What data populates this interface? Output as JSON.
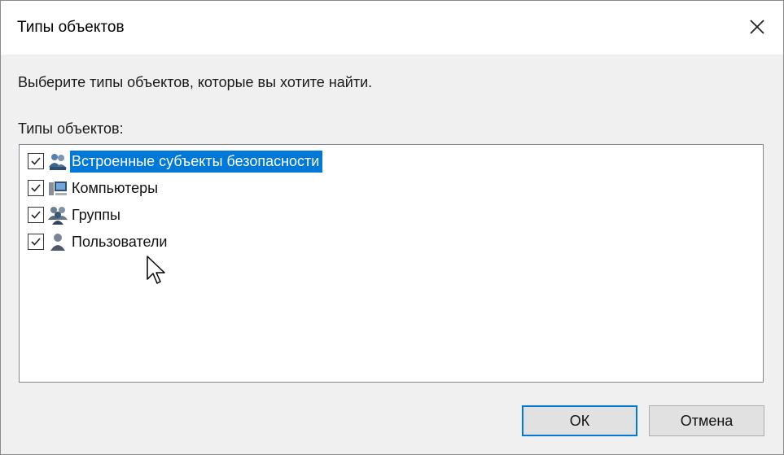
{
  "dialog": {
    "title": "Типы объектов",
    "instruction": "Выберите типы объектов, которые вы хотите найти.",
    "list_label": "Типы объектов:",
    "items": [
      {
        "label": "Встроенные субъекты безопасности",
        "checked": true,
        "selected": true,
        "icon": "security-principals-icon"
      },
      {
        "label": "Компьютеры",
        "checked": true,
        "selected": false,
        "icon": "computer-icon"
      },
      {
        "label": "Группы",
        "checked": true,
        "selected": false,
        "icon": "group-icon"
      },
      {
        "label": "Пользователи",
        "checked": true,
        "selected": false,
        "icon": "user-icon"
      }
    ],
    "ok_label": "ОК",
    "cancel_label": "Отмена"
  },
  "colors": {
    "selection": "#0078d7",
    "default_button_border": "#0078d7"
  }
}
